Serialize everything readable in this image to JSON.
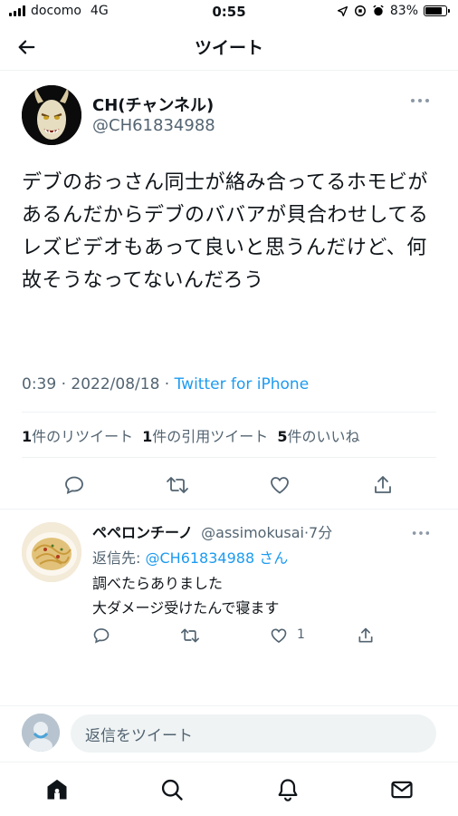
{
  "status_bar": {
    "carrier": "docomo",
    "network": "4G",
    "time": "0:55",
    "battery": "83%"
  },
  "header": {
    "title": "ツイート"
  },
  "tweet": {
    "display_name": "CH(チャンネル)",
    "handle": "@CH61834988",
    "text": "デブのおっさん同士が絡み合ってるホモビがあるんだからデブのババアが貝合わせしてるレズビデオもあって良いと思うんだけど、何故そうなってないんだろう",
    "time": "0:39",
    "date": "2022/08/18",
    "source": "Twitter for iPhone",
    "stats": {
      "retweets_count": "1",
      "retweets_label": "件のリツイート",
      "quotes_count": "1",
      "quotes_label": "件の引用ツイート",
      "likes_count": "5",
      "likes_label": "件のいいね"
    }
  },
  "reply": {
    "display_name": "ペペロンチーノ",
    "handle": "@assimokusai",
    "time_ago": "7分",
    "reply_to_prefix": "返信先: ",
    "reply_to_handle": "@CH61834988",
    "reply_to_suffix": " さん",
    "line1": "調べたらありました",
    "line2": "大ダメージ受けたんで寝ます",
    "like_count": "1"
  },
  "composer": {
    "placeholder": "返信をツイート"
  },
  "colors": {
    "link": "#1d9bf0",
    "secondary_text": "#536471",
    "text": "#0f1419"
  }
}
